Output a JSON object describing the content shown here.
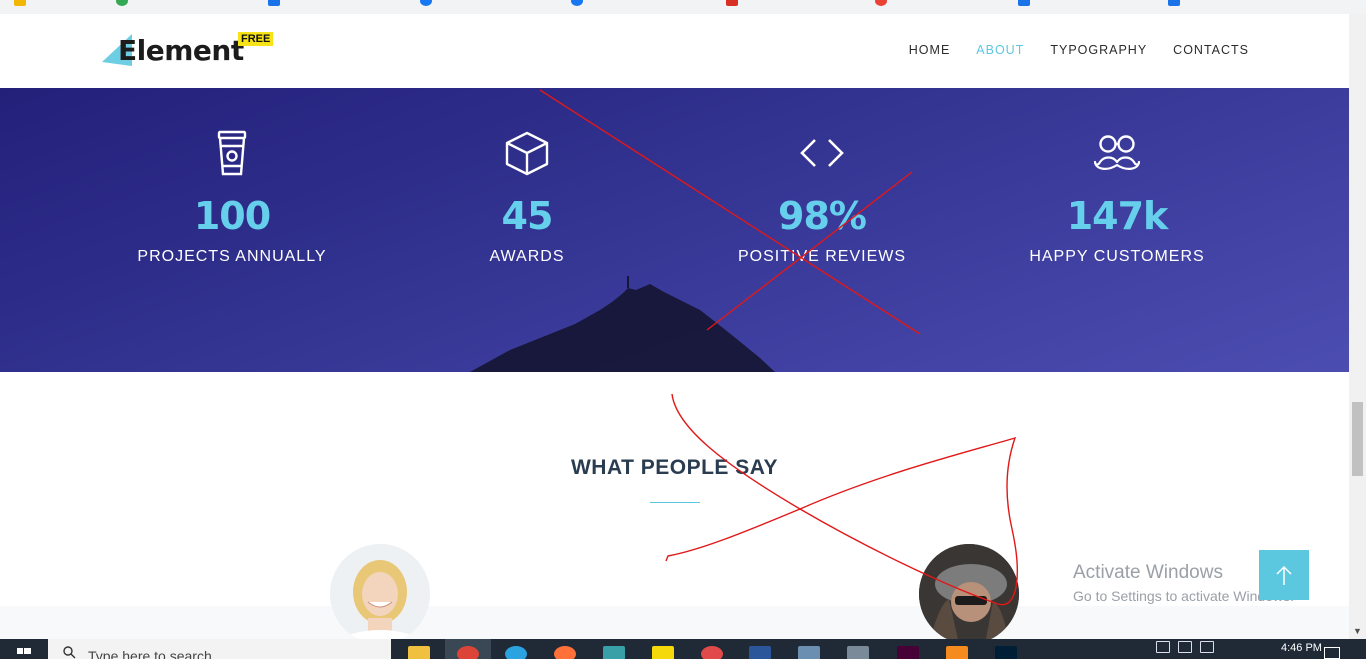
{
  "nav": {
    "logo_text": "Element",
    "logo_badge": "FREE",
    "items": [
      {
        "label": "HOME",
        "active": false
      },
      {
        "label": "ABOUT",
        "active": true
      },
      {
        "label": "TYPOGRAPHY",
        "active": false
      },
      {
        "label": "CONTACTS",
        "active": false
      }
    ]
  },
  "stats": [
    {
      "icon": "coffee-cup-icon",
      "value": "100",
      "label": "PROJECTS ANNUALLY"
    },
    {
      "icon": "box-icon",
      "value": "45",
      "label": "AWARDS"
    },
    {
      "icon": "code-icon",
      "value": "98%",
      "label": "POSITIVE REVIEWS"
    },
    {
      "icon": "glasses-mustache-icon",
      "value": "147k",
      "label": "HAPPY CUSTOMERS"
    }
  ],
  "testimonials": {
    "title": "WHAT PEOPLE SAY"
  },
  "overlay": {
    "activate_title": "Activate Windows",
    "activate_subtitle": "Go to Settings to activate Windows."
  },
  "taskbar": {
    "search_placeholder": "Type here to search",
    "clock": "4:46 PM"
  },
  "colors": {
    "accent": "#5cc8e0",
    "stats_bg": "#2f2f8c",
    "stat_number": "#66d0ec",
    "logo_badge": "#f7e318",
    "title": "#2a3c50",
    "scribble": "#e01818"
  }
}
